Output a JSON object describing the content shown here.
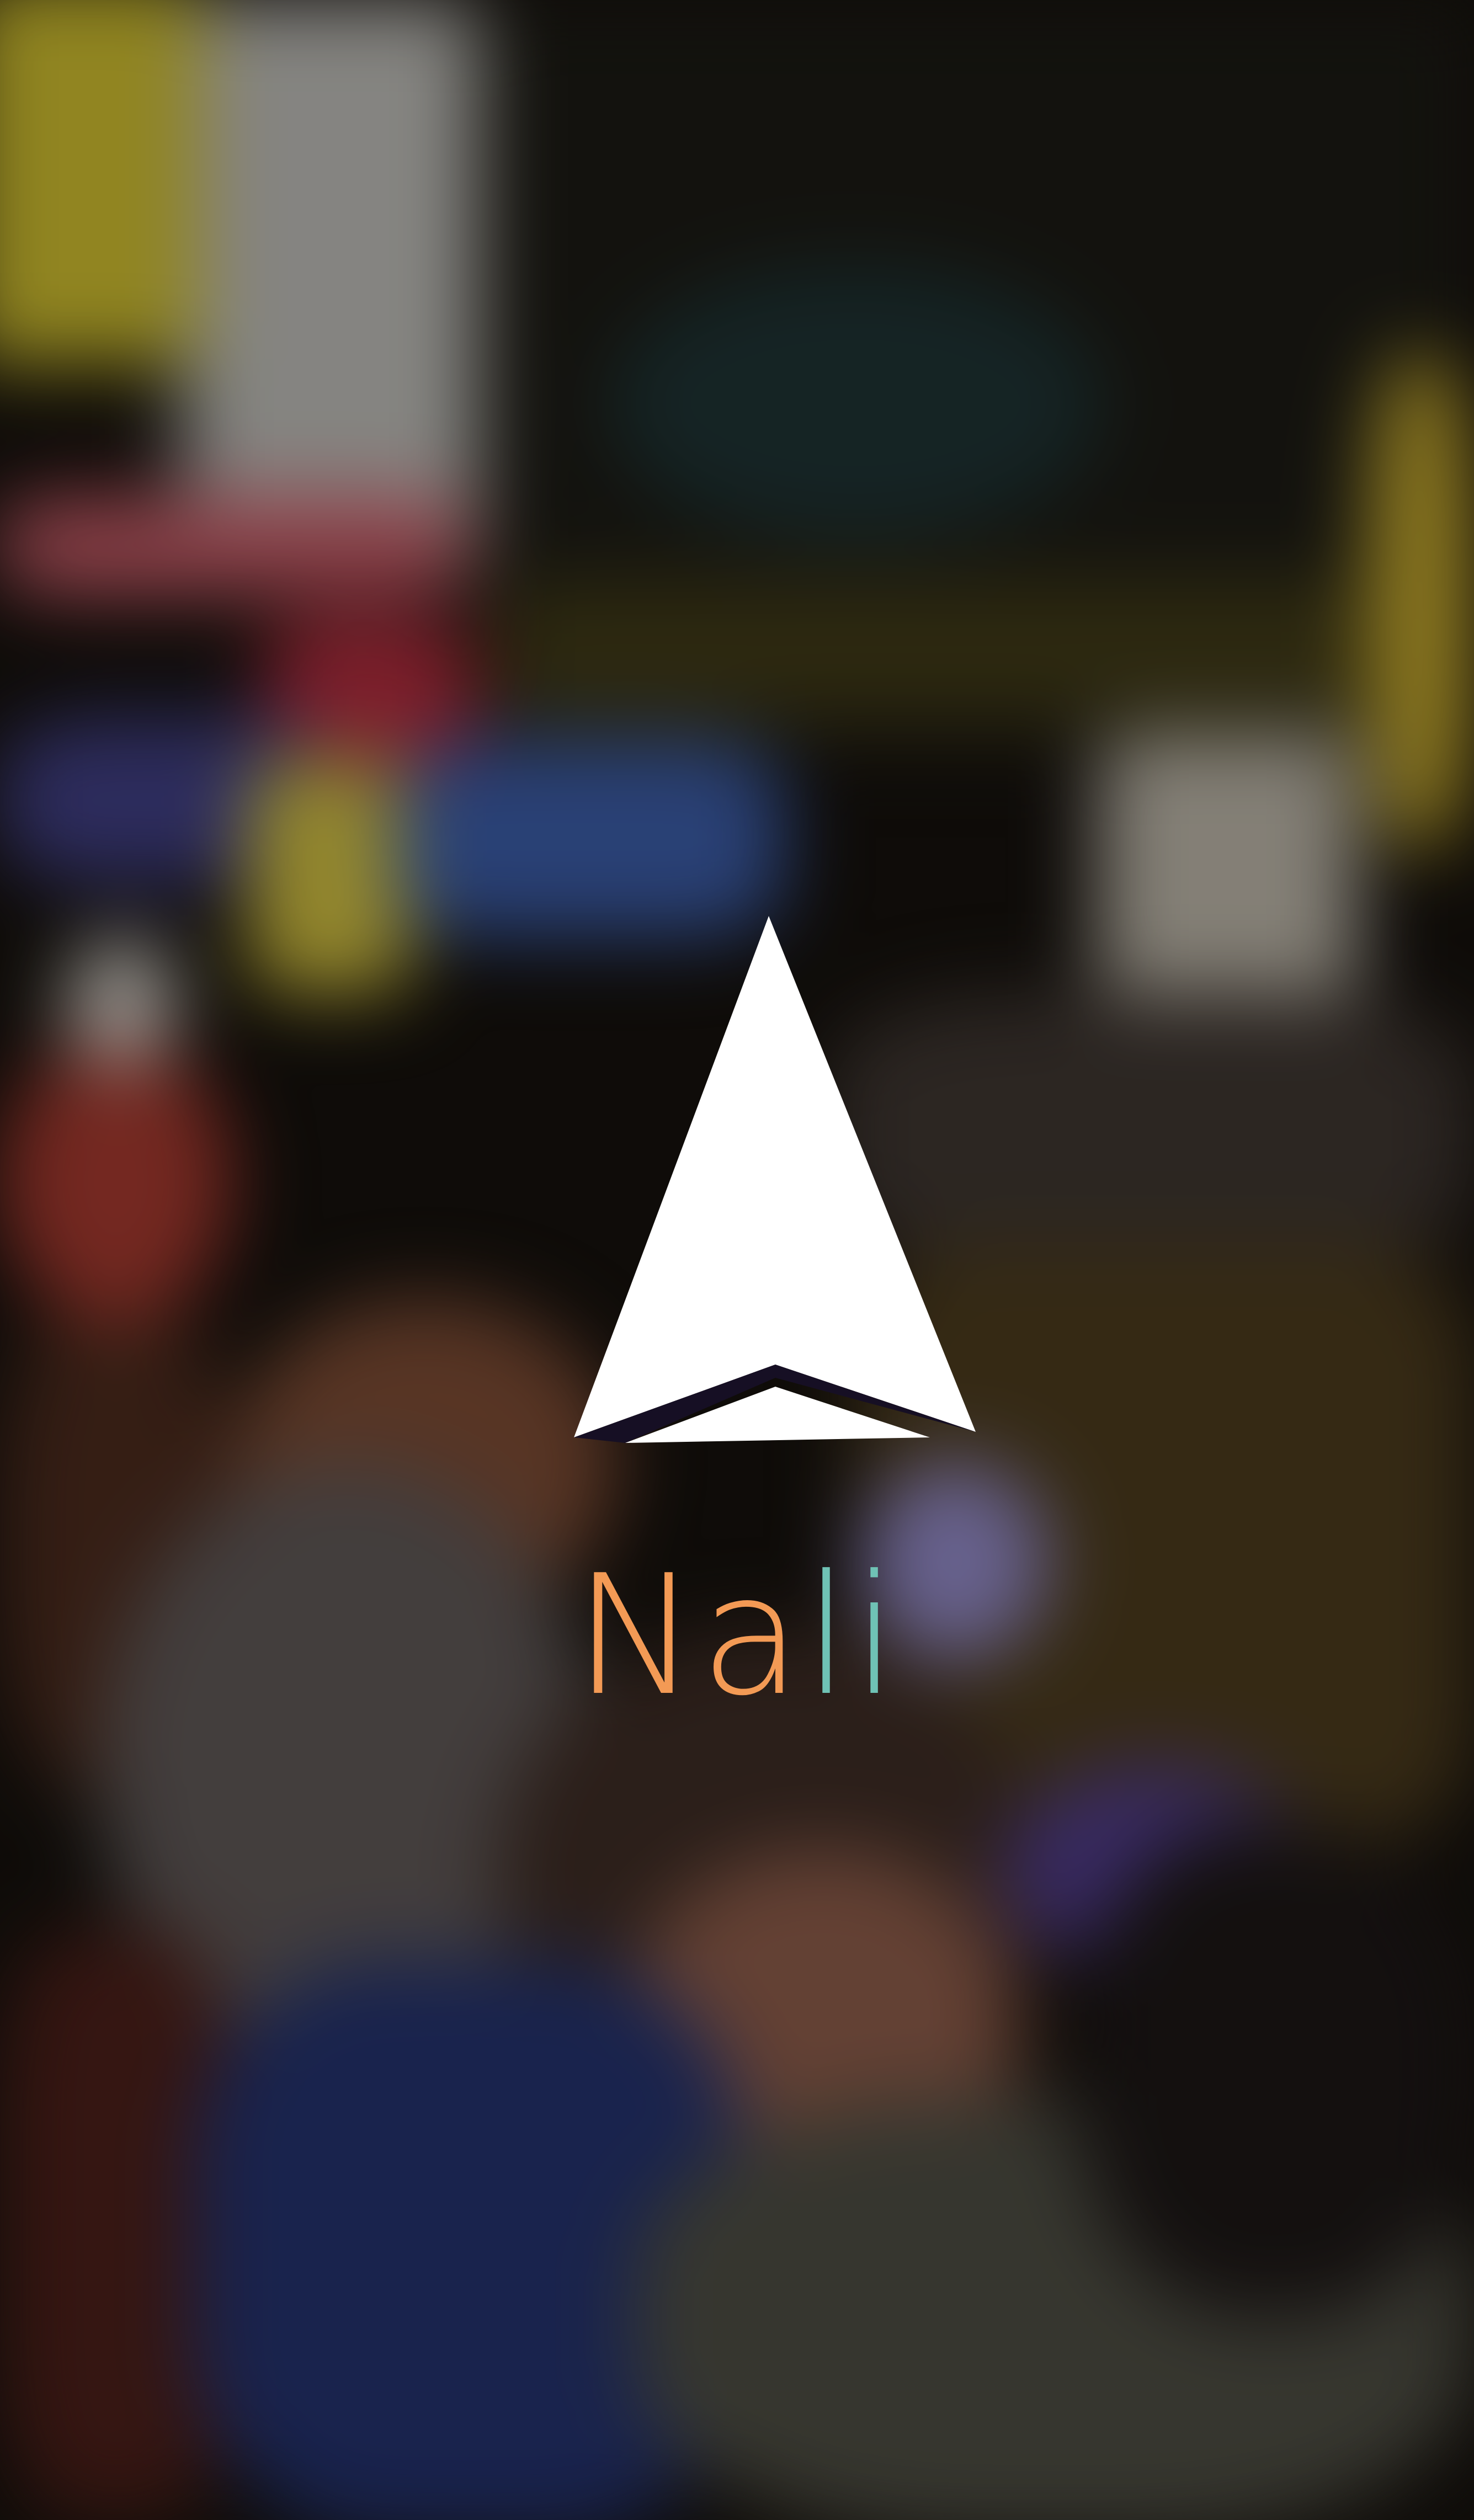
{
  "splash": {
    "app_name_parts": [
      {
        "text": "Na",
        "color": "#f39a55"
      },
      {
        "text": "li",
        "color": "#6fc2b5"
      }
    ],
    "logo_icon": "navigation-arrow-icon",
    "logo_colors": {
      "arrow_fill": "#ffffff",
      "chevron_shadow": "#160f24"
    },
    "background": "blurred-night-street-crowd-photo"
  }
}
